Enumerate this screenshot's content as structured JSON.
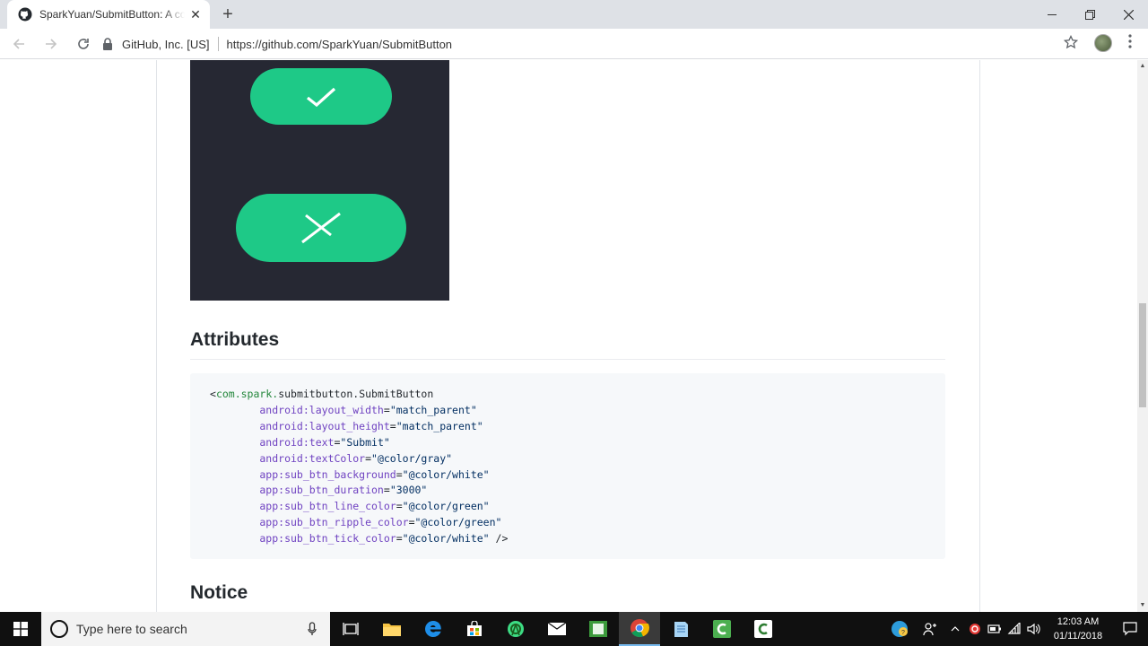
{
  "browser": {
    "tab_title": "SparkYuan/SubmitButton: A cool",
    "tab_close": "✕",
    "new_tab": "+",
    "site_identity": "GitHub, Inc. [US]",
    "url": "https://github.com/SparkYuan/SubmitButton"
  },
  "page": {
    "attributes_heading": "Attributes",
    "notice_heading": "Notice",
    "code_lines": [
      [
        {
          "t": "<",
          "c": "plain"
        },
        {
          "t": "com.spark.",
          "c": "tag"
        },
        {
          "t": "submitbutton.SubmitButton",
          "c": "plain"
        }
      ],
      [
        {
          "t": "        android:layout_width",
          "c": "attr"
        },
        {
          "t": "=",
          "c": "plain"
        },
        {
          "t": "\"match_parent\"",
          "c": "str"
        }
      ],
      [
        {
          "t": "        android:layout_height",
          "c": "attr"
        },
        {
          "t": "=",
          "c": "plain"
        },
        {
          "t": "\"match_parent\"",
          "c": "str"
        }
      ],
      [
        {
          "t": "        android:text",
          "c": "attr"
        },
        {
          "t": "=",
          "c": "plain"
        },
        {
          "t": "\"Submit\"",
          "c": "str"
        }
      ],
      [
        {
          "t": "        android:textColor",
          "c": "attr"
        },
        {
          "t": "=",
          "c": "plain"
        },
        {
          "t": "\"@color/gray\"",
          "c": "str"
        }
      ],
      [
        {
          "t": "        app:sub_btn_background",
          "c": "attr"
        },
        {
          "t": "=",
          "c": "plain"
        },
        {
          "t": "\"@color/white\"",
          "c": "str"
        }
      ],
      [
        {
          "t": "        app:sub_btn_duration",
          "c": "attr"
        },
        {
          "t": "=",
          "c": "plain"
        },
        {
          "t": "\"3000\"",
          "c": "str"
        }
      ],
      [
        {
          "t": "        app:sub_btn_line_color",
          "c": "attr"
        },
        {
          "t": "=",
          "c": "plain"
        },
        {
          "t": "\"@color/green\"",
          "c": "str"
        }
      ],
      [
        {
          "t": "        app:sub_btn_ripple_color",
          "c": "attr"
        },
        {
          "t": "=",
          "c": "plain"
        },
        {
          "t": "\"@color/green\"",
          "c": "str"
        }
      ],
      [
        {
          "t": "        app:sub_btn_tick_color",
          "c": "attr"
        },
        {
          "t": "=",
          "c": "plain"
        },
        {
          "t": "\"@color/white\"",
          "c": "str"
        },
        {
          "t": " />",
          "c": "plain"
        }
      ]
    ]
  },
  "taskbar": {
    "search_placeholder": "Type here to search",
    "time": "12:03 AM",
    "date": "01/11/2018"
  },
  "colors": {
    "accent_green": "#1ec987",
    "demo_bg": "#262833"
  }
}
